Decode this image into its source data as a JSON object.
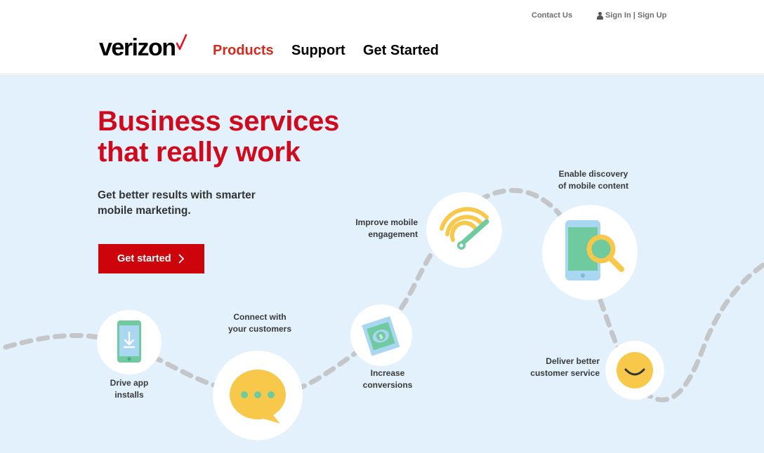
{
  "header": {
    "contact_label": "Contact Us",
    "sign_label": "Sign In | Sign Up",
    "logo_text": "verizon",
    "nav": {
      "products": "Products",
      "support": "Support",
      "get_started": "Get Started"
    }
  },
  "hero": {
    "headline_line1": "Business services",
    "headline_line2": "that really work",
    "subhead_line1": "Get better results with smarter",
    "subhead_line2": "mobile marketing.",
    "cta_label": "Get started",
    "steps": [
      {
        "line1": "Drive app",
        "line2": "installs",
        "icon": "phone-download-icon"
      },
      {
        "line1": "Connect with",
        "line2": "your customers",
        "icon": "chat-bubble-icon"
      },
      {
        "line1": "Increase",
        "line2": "conversions",
        "icon": "money-card-icon"
      },
      {
        "line1": "Improve mobile",
        "line2": "engagement",
        "icon": "signal-gauge-icon"
      },
      {
        "line1": "Enable discovery",
        "line2": "of mobile content",
        "icon": "phone-search-icon"
      },
      {
        "line1": "Deliver better",
        "line2": "customer service",
        "icon": "smiley-icon"
      }
    ]
  },
  "colors": {
    "brand_red": "#d1091d",
    "hero_bg": "#e2f1fb",
    "icon_yellow": "#f7c84a",
    "icon_green": "#6fcaa0",
    "icon_blue": "#a9d6f0",
    "path_gray": "#c4c6c8"
  }
}
